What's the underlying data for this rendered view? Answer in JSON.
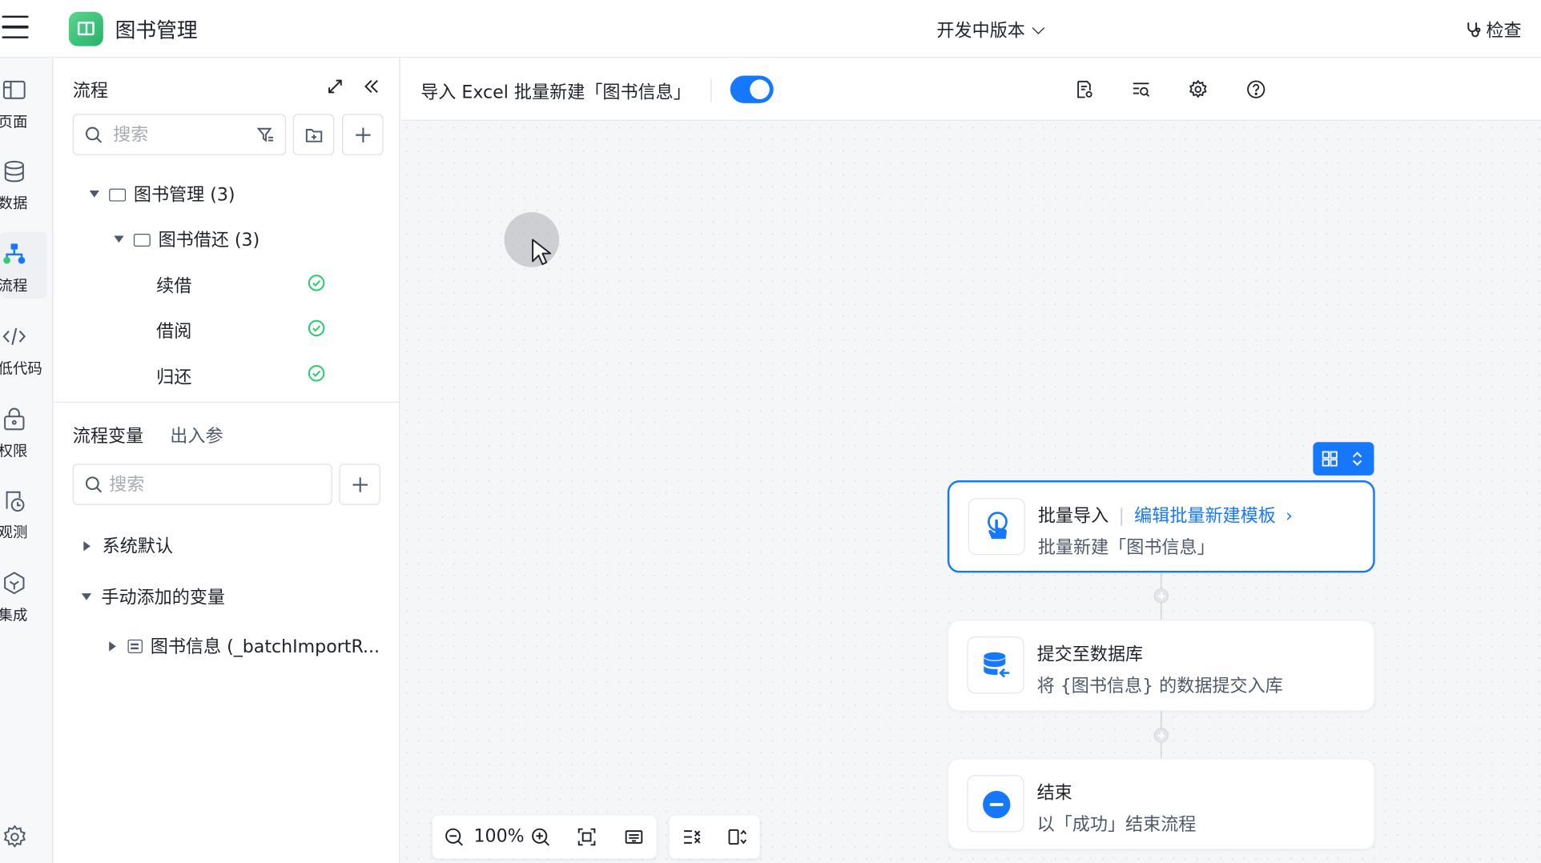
{
  "header": {
    "app_title": "图书管理",
    "version_label": "开发中版本",
    "check_label": "检查"
  },
  "rail": {
    "items": [
      {
        "label": "页面",
        "icon": "page-icon"
      },
      {
        "label": "数据",
        "icon": "database-icon"
      },
      {
        "label": "流程",
        "icon": "flow-icon",
        "active": true
      },
      {
        "label": "低代码",
        "icon": "code-icon"
      },
      {
        "label": "权限",
        "icon": "lock-icon"
      },
      {
        "label": "观测",
        "icon": "observe-icon"
      },
      {
        "label": "集成",
        "icon": "integration-icon"
      }
    ]
  },
  "process_panel": {
    "title": "流程",
    "search_placeholder": "搜索",
    "tree": {
      "root": "图书管理 (3)",
      "folder": "图书借还 (3)",
      "items": [
        "续借",
        "借阅",
        "归还"
      ]
    }
  },
  "variables_panel": {
    "tabs": [
      "流程变量",
      "出入参"
    ],
    "search_placeholder": "搜索",
    "groups": [
      "系统默认",
      "手动添加的变量"
    ],
    "variable": "图书信息 (_batchImportR..."
  },
  "toolbar": {
    "flow_name": "导入 Excel 批量新建「图书信息」",
    "enabled": true
  },
  "nodes": [
    {
      "title": "批量导入",
      "link": "编辑批量新建模板",
      "subtitle": "批量新建「图书信息」",
      "icon": "hand-pointer-icon"
    },
    {
      "title": "提交至数据库",
      "subtitle": "将 {图书信息} 的数据提交入库",
      "icon": "database-submit-icon"
    },
    {
      "title": "结束",
      "subtitle": "以「成功」结束流程",
      "icon": "end-icon"
    }
  ],
  "zoom": {
    "level": "100%"
  },
  "colors": {
    "accent": "#1677ff",
    "success": "#2ecc71",
    "logo": "#34c77b"
  }
}
